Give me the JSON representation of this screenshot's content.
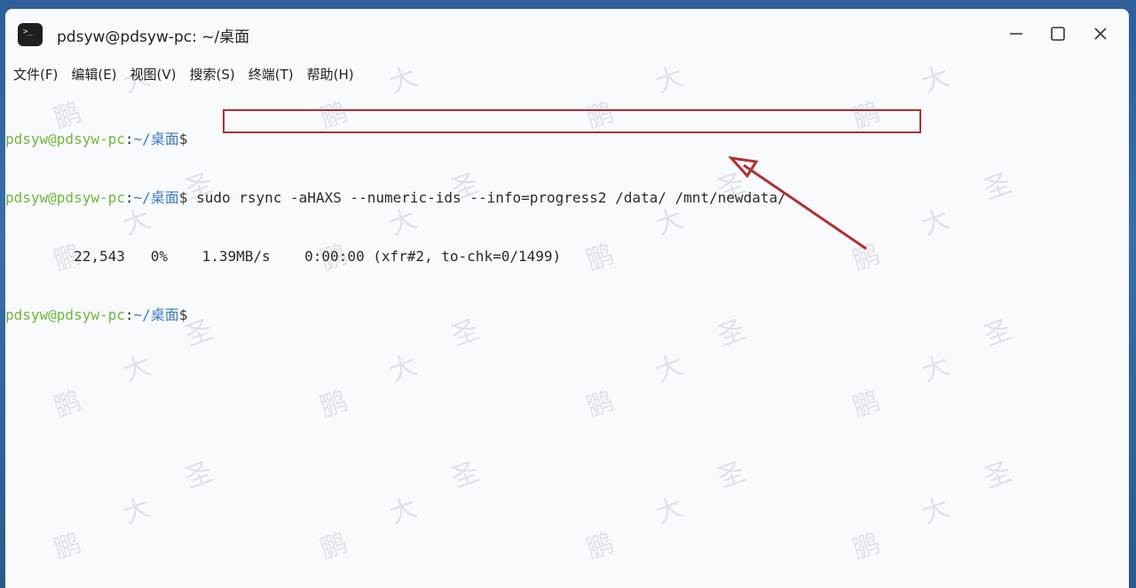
{
  "window": {
    "title": "pdsyw@pdsyw-pc: ~/桌面",
    "app_icon_glyph": ">_"
  },
  "menu": [
    {
      "label": "文件(F)"
    },
    {
      "label": "编辑(E)"
    },
    {
      "label": "视图(V)"
    },
    {
      "label": "搜索(S)"
    },
    {
      "label": "终端(T)"
    },
    {
      "label": "帮助(H)"
    }
  ],
  "terminal": {
    "prompt_user": "pdsyw@pdsyw-pc",
    "prompt_sep": ":",
    "prompt_path": "~/桌面",
    "prompt_dollar": "$",
    "command": "sudo rsync -aHAXS --numeric-ids --info=progress2 /data/ /mnt/newdata/",
    "progress_line": "        22,543   0%    1.39MB/s    0:00:00 (xfr#2, to-chk=0/1499)"
  },
  "watermark": {
    "chars": [
      "鹏",
      "大",
      "圣"
    ]
  },
  "colors": {
    "highlight_box": "#a83232",
    "prompt_user": "#72b63a",
    "prompt_path": "#3a7abf"
  }
}
